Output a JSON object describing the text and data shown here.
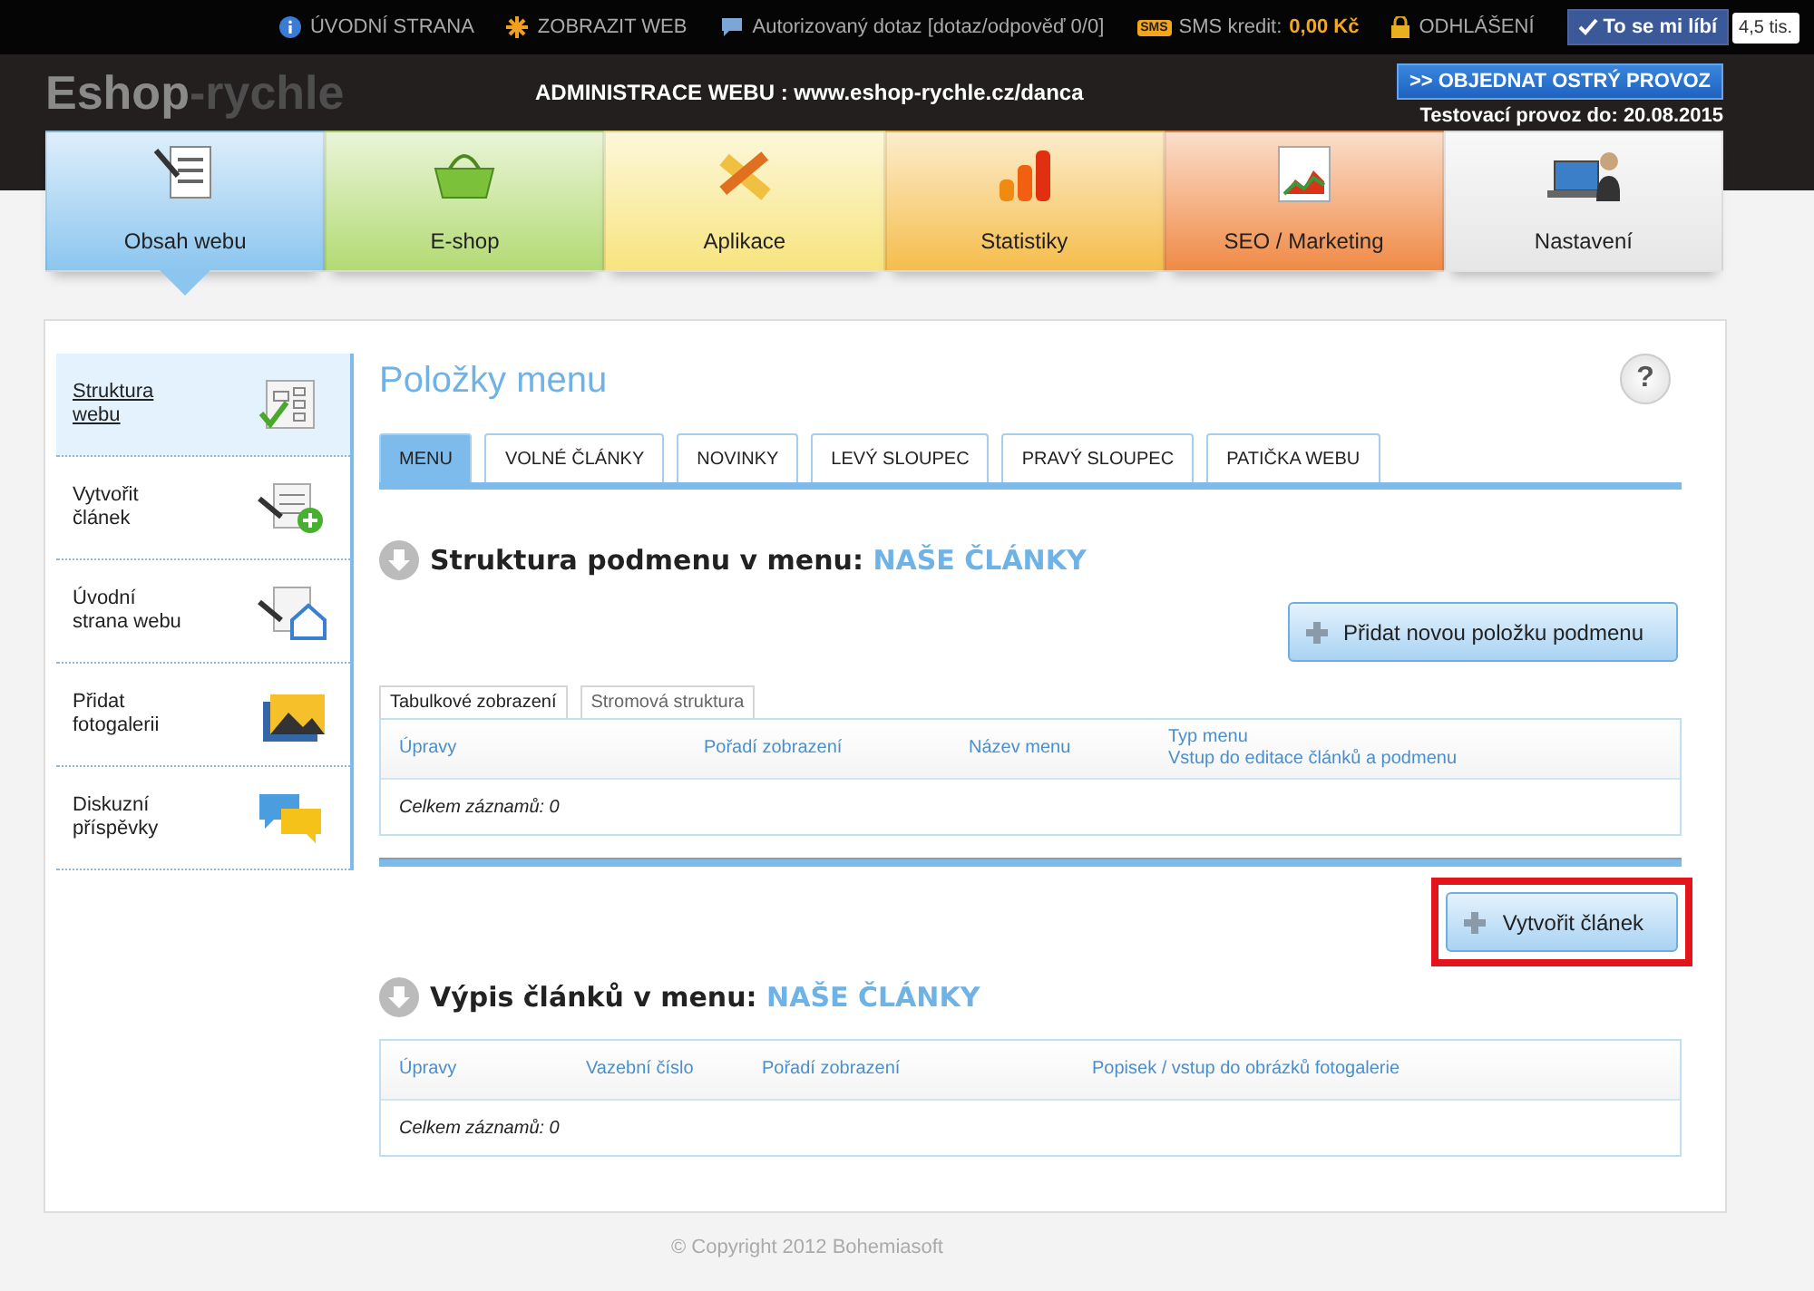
{
  "top_bar": {
    "links": [
      {
        "label": "ÚVODNÍ STRANA"
      },
      {
        "label": "ZOBRAZIT WEB"
      },
      {
        "label": "Autorizovaný dotaz [dotaz/odpověď 0/0]"
      }
    ],
    "sms": {
      "badge": "SMS",
      "label": "SMS kredit:",
      "value": "0,00 Kč"
    },
    "logout": "ODHLÁŠENÍ",
    "like_button": "To se mi líbí",
    "like_count": "4,5 tis."
  },
  "header": {
    "logo_main": "Eshop",
    "logo_suffix": "-rychle",
    "title": "ADMINISTRACE WEBU : www.eshop-rychle.cz/danca",
    "order_button": ">> OBJEDNAT OSTRÝ PROVOZ",
    "trial": "Testovací provoz do: 20.08.2015"
  },
  "nav": [
    {
      "label": "Obsah webu",
      "selected": true,
      "color": "#8cc6ef"
    },
    {
      "label": "E-shop",
      "selected": false,
      "color": "#b3da74"
    },
    {
      "label": "Aplikace",
      "selected": false,
      "color": "#f7e47e"
    },
    {
      "label": "Statistiky",
      "selected": false,
      "color": "#f5bd4c"
    },
    {
      "label": "SEO / Marketing",
      "selected": false,
      "color": "#f08a46"
    },
    {
      "label": "Nastavení",
      "selected": false,
      "color": "#e6e6e6"
    }
  ],
  "sidebar": [
    {
      "lines": [
        "Struktura",
        "webu"
      ],
      "selected": true
    },
    {
      "lines": [
        "Vytvořit",
        "článek"
      ],
      "selected": false
    },
    {
      "lines": [
        "Úvodní",
        "strana webu"
      ],
      "selected": false
    },
    {
      "lines": [
        "Přidat",
        "fotogalerii"
      ],
      "selected": false
    },
    {
      "lines": [
        "Diskuzní",
        "příspěvky"
      ],
      "selected": false
    }
  ],
  "page_title": "Položky menu",
  "help": "?",
  "tabs": [
    {
      "label": "MENU",
      "selected": true
    },
    {
      "label": "VOLNÉ ČLÁNKY",
      "selected": false
    },
    {
      "label": "NOVINKY",
      "selected": false
    },
    {
      "label": "LEVÝ SLOUPEC",
      "selected": false
    },
    {
      "label": "PRAVÝ SLOUPEC",
      "selected": false
    },
    {
      "label": "PATIČKA WEBU",
      "selected": false
    }
  ],
  "sections": [
    {
      "heading": "Struktura podmenu v menu:",
      "menu_name": "NAŠE ČLÁNKY",
      "button": {
        "label": "Přidat novou položku podmenu",
        "highlighted": false
      },
      "view_tabs": [
        {
          "label": "Tabulkové zobrazení",
          "selected": true
        },
        {
          "label": "Stromová struktura",
          "selected": false
        }
      ],
      "columns": [
        {
          "lines": [
            "Úpravy"
          ]
        },
        {
          "lines": [
            "Pořadí zobrazení"
          ]
        },
        {
          "lines": [
            "Název menu"
          ]
        },
        {
          "lines": [
            "Typ menu",
            "Vstup do editace článků a podmenu"
          ]
        }
      ],
      "total": "Celkem záznamů: 0"
    },
    {
      "heading": "Výpis článků v menu:",
      "menu_name": "NAŠE ČLÁNKY",
      "button": {
        "label": "Vytvořit článek",
        "highlighted": true
      },
      "columns": [
        {
          "lines": [
            "Úpravy"
          ]
        },
        {
          "lines": [
            "Vazební číslo"
          ]
        },
        {
          "lines": [
            "Pořadí zobrazení"
          ]
        },
        {
          "lines": [
            "Popisek / vstup do obrázků fotogalerie"
          ]
        }
      ],
      "total": "Celkem záznamů: 0"
    }
  ],
  "copyright": "© Copyright 2012 Bohemiasoft"
}
